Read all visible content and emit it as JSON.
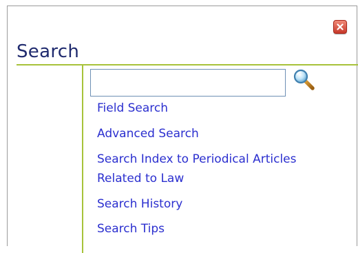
{
  "panel": {
    "title": "Search"
  },
  "search": {
    "query": "",
    "placeholder": ""
  },
  "links": {
    "field_search": "Field Search",
    "advanced_search": "Advanced Search",
    "periodical_line1": "Search Index to Periodical Articles",
    "periodical_line2": "Related to Law",
    "search_history": "Search History",
    "search_tips": "Search Tips"
  },
  "icons": {
    "close": "close-icon",
    "search": "magnifier-icon"
  },
  "colors": {
    "title": "#1f2a6e",
    "accent_rule": "#a7c239",
    "link": "#2b2fcf",
    "close_button": "#c7392a",
    "input_border": "#6d8fb4"
  }
}
